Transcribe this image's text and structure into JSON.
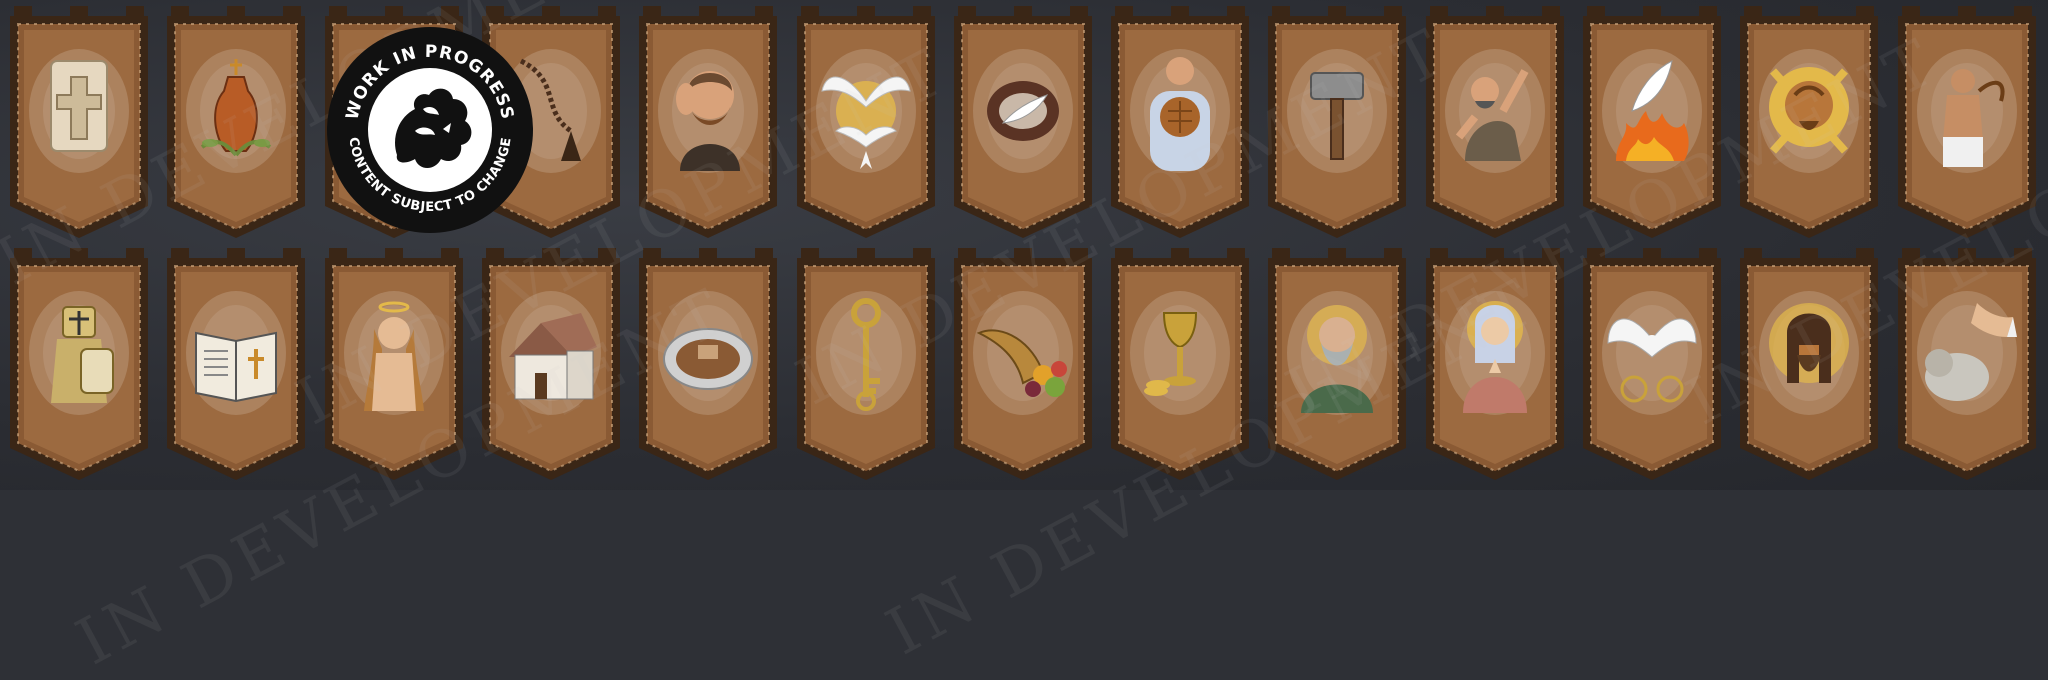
{
  "badge": {
    "top_text": "WORK IN PROGRESS",
    "bottom_text": "CONTENT SUBJECT TO CHANGE"
  },
  "watermark": {
    "text": "IN DEVELOPMENT"
  },
  "colors": {
    "background": "#2e3036",
    "banner_fill": "#8a5a34",
    "banner_border": "#3a2616",
    "badge_black": "#111111",
    "badge_white": "#ffffff"
  },
  "banners_row_1": [
    "stone-cross-tablet-icon",
    "amphora-olive-branch-icon",
    "rosary-icon",
    "rosary-icon-hidden",
    "monk-listening-icon",
    "white-doves-icon",
    "feather-nest-icon",
    "priest-bread-icon",
    "hammer-icon",
    "preacher-icon",
    "feather-flame-icon",
    "christ-halo-cross-icon",
    "flagellant-icon"
  ],
  "banners_row_2": [
    "crusader-knight-icon",
    "open-bible-icon",
    "saint-woman-praying-icon",
    "cottage-icon",
    "offering-plate-icon",
    "golden-key-icon",
    "cornucopia-icon",
    "chalice-coins-icon",
    "bearded-saint-icon",
    "virgin-mary-icon",
    "holy-spirit-dove-icon",
    "christ-portrait-icon",
    "hand-lamb-icon"
  ]
}
